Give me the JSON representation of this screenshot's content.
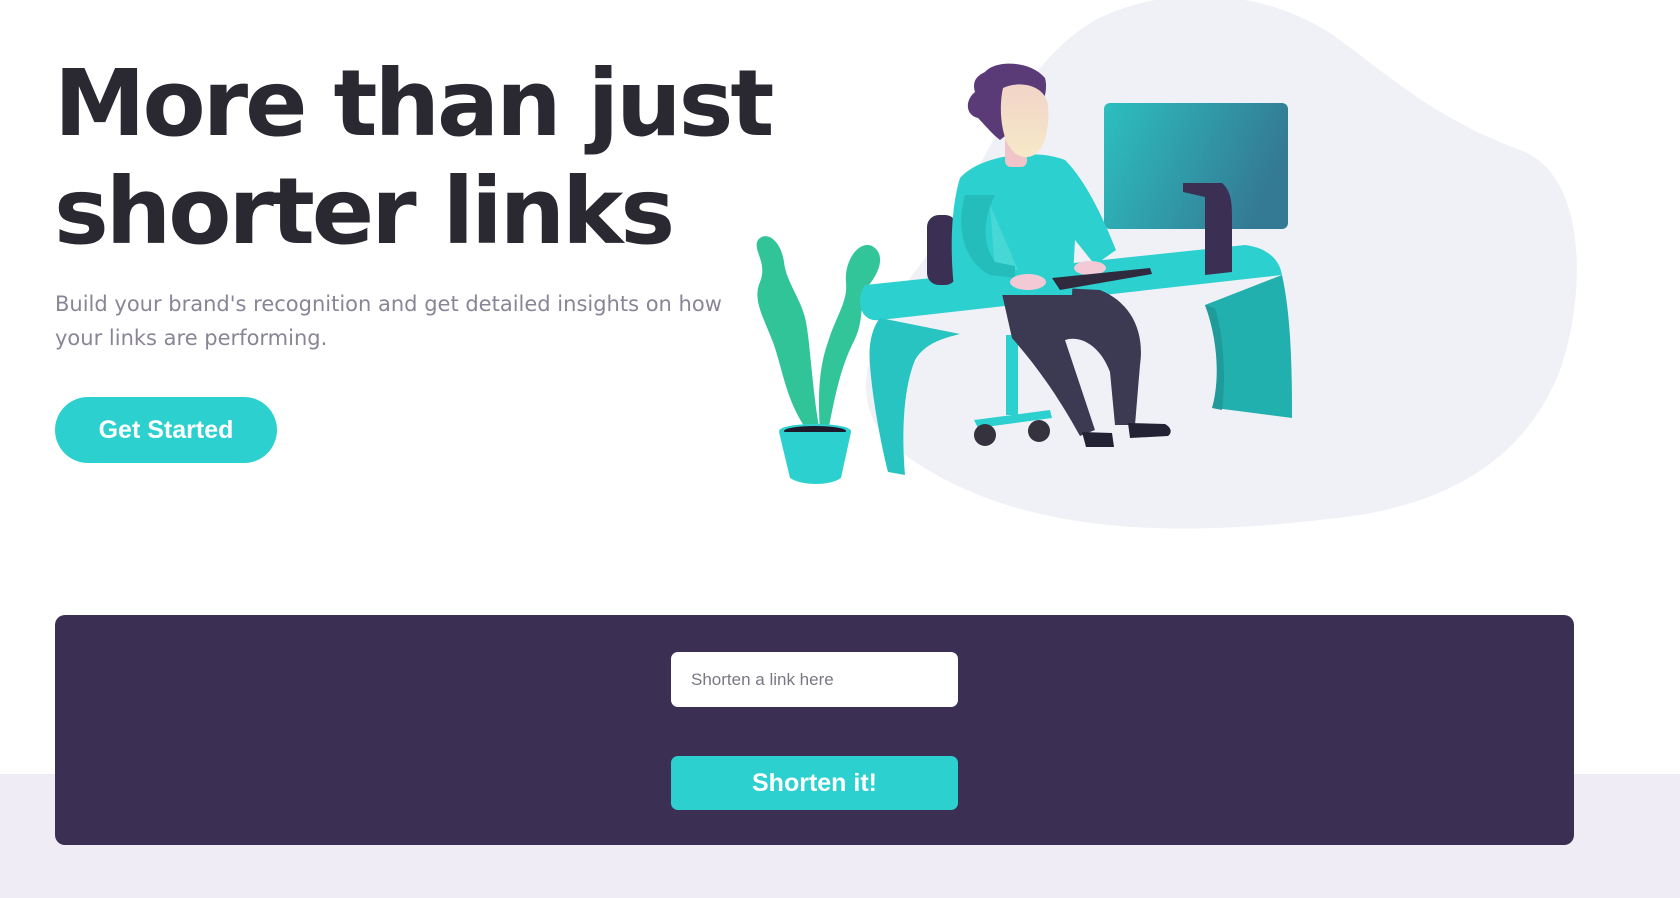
{
  "hero": {
    "title": "More than just shorter links",
    "subtitle": "Build your brand's recognition and get detailed insights on how your links are performing.",
    "cta_label": "Get Started"
  },
  "shortener": {
    "input_value": "",
    "input_placeholder": "Shorten a link here",
    "submit_label": "Shorten it!"
  },
  "illustration": {
    "icon": "person-working-at-desk-illustration"
  },
  "colors": {
    "accent": "#2cd1cf",
    "panel": "#3b3054",
    "heading": "#2a2830",
    "body_text": "#8a8596",
    "band": "#efecf6",
    "blob": "#f0f1f6"
  }
}
